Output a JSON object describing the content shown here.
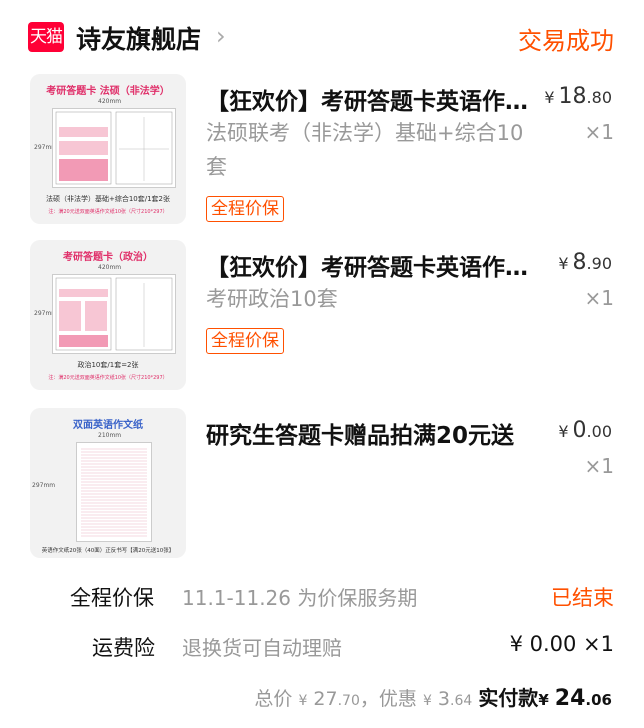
{
  "header": {
    "logo_text": "天猫",
    "shop_name": "诗友旗舰店",
    "chevron": "›",
    "status": "交易成功"
  },
  "items": [
    {
      "title": "【狂欢价】考研答题卡英语作文纸",
      "spec": "法硕联考（非法学）基础+综合10套",
      "badge": "全程价保",
      "price_currency": "¥",
      "price_int": "18",
      "price_dec": ".80",
      "qty": "×1",
      "thumb": {
        "heading": "考研答题卡  法硕（非法学）",
        "width_label": "420mm",
        "height_label": "297mm",
        "caption": "法硕（非法学）基础+综合10套/1套2张",
        "note": "注：满20元送双面英语作文纸10张（尺寸210*297）"
      }
    },
    {
      "title": "【狂欢价】考研答题卡英语作文纸",
      "spec": "考研政治10套",
      "badge": "全程价保",
      "price_currency": "¥",
      "price_int": "8",
      "price_dec": ".90",
      "qty": "×1",
      "thumb": {
        "heading": "考研答题卡（政治）",
        "width_label": "420mm",
        "height_label": "297mm",
        "caption": "政治10套/1套=2张",
        "note": "注：满20元送双面英语作文纸10张（尺寸210*297）"
      }
    },
    {
      "title": "研究生答题卡赠品拍满20元送",
      "price_currency": "¥",
      "price_int": "0",
      "price_dec": ".00",
      "qty": "×1",
      "thumb": {
        "heading": "双面英语作文纸",
        "width_label": "210mm",
        "height_label": "297mm",
        "caption": "英语作文纸20张（40面）正反书写【满20元送10张】"
      }
    }
  ],
  "price_protect": {
    "label": "全程价保",
    "desc": "11.1-11.26 为价保服务期",
    "status": "已结束"
  },
  "shipping_insurance": {
    "label": "运费险",
    "desc": "退换货可自动理赔",
    "value": "¥ 0.00 ×1"
  },
  "totals": {
    "total_label": "总价",
    "total_currency": "¥",
    "total_int": "27",
    "total_dec": ".70",
    "discount_label": "，优惠",
    "discount_currency": "¥",
    "discount_int": "3",
    "discount_dec": ".64",
    "paid_label": "实付款",
    "paid_currency": "¥",
    "paid_int": "24",
    "paid_dec": ".06"
  },
  "colors": {
    "accent": "#ff5000",
    "tmall_red": "#ff0036",
    "thumb_pink": "#e0306a",
    "muted": "#999999"
  }
}
